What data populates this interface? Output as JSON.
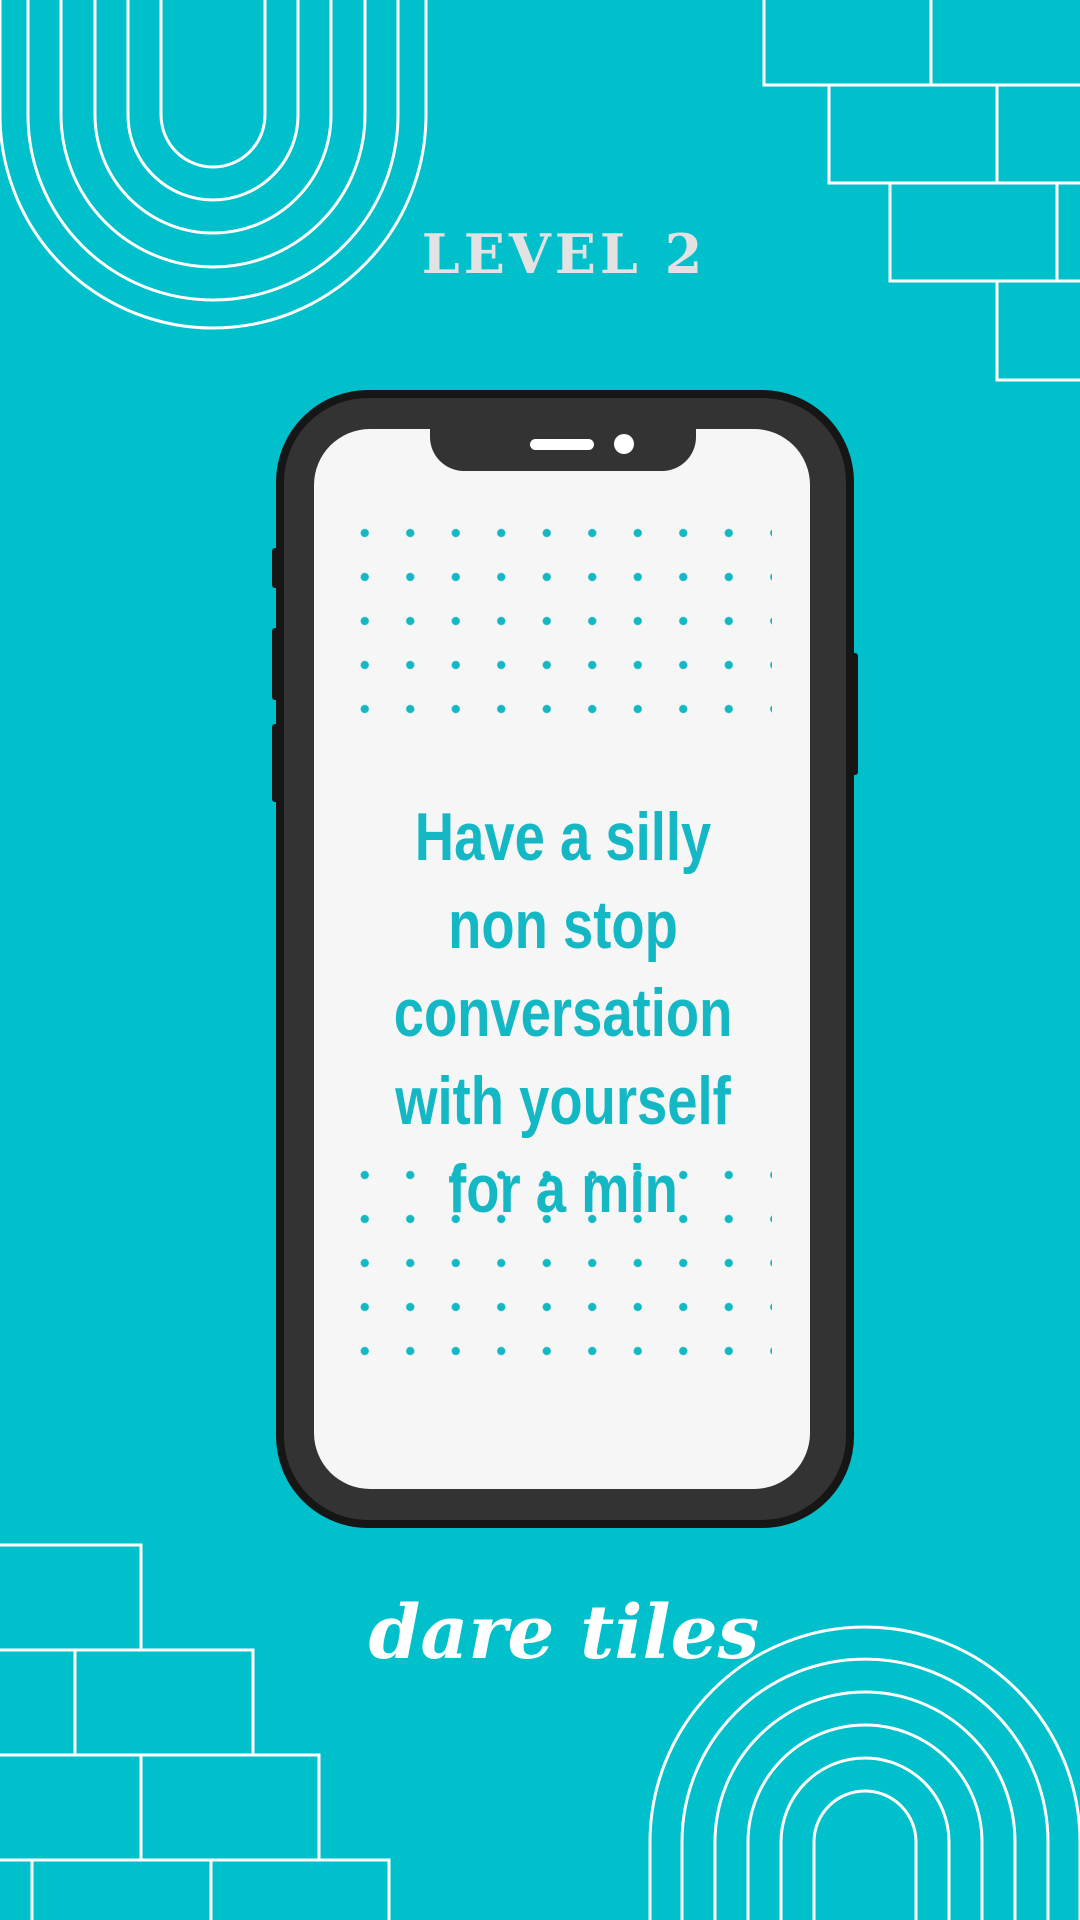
{
  "level": {
    "title": "LEVEL 2"
  },
  "card": {
    "dare": "Have a silly non stop conversation with yourself for a min"
  },
  "brand": {
    "name": "dare tiles"
  },
  "colors": {
    "background": "#00c0cb",
    "accent": "#14b8c4",
    "phone_body": "#333333",
    "screen": "#f6f6f6",
    "title": "#e2e2e2"
  }
}
